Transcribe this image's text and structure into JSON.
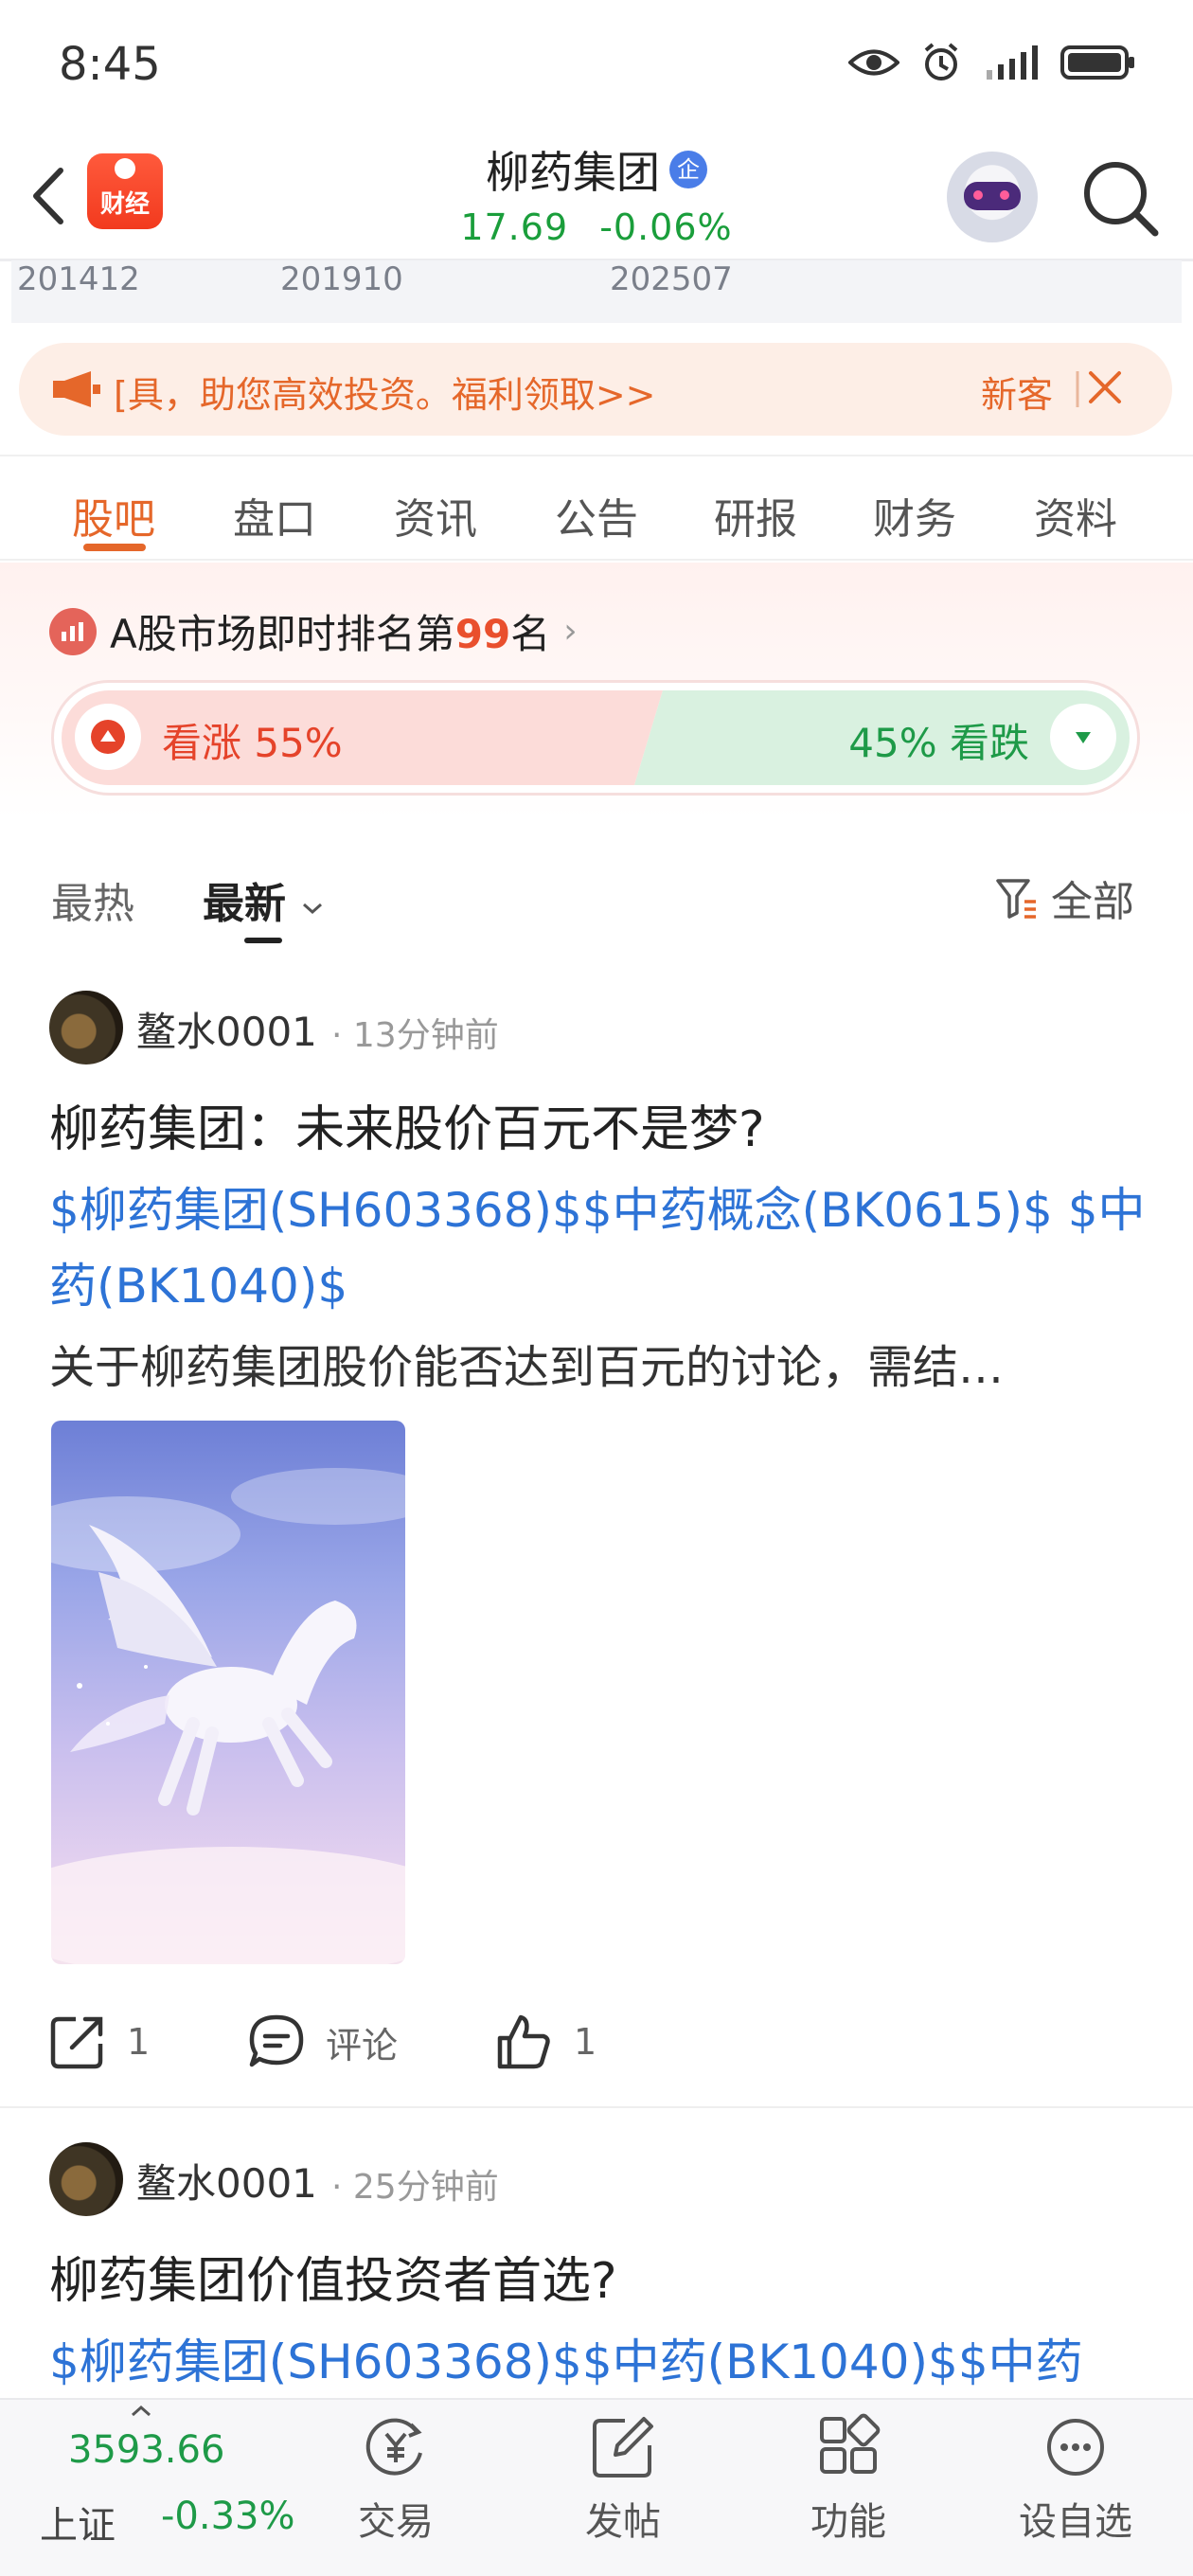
{
  "status": {
    "time": "8:45"
  },
  "header": {
    "logo_label": "财经",
    "stock_name": "柳药集团",
    "badge": "企",
    "price": "17.69",
    "change_pct": "-0.06%"
  },
  "chart_strip": {
    "ticks": [
      "201412",
      "201910",
      "202507"
    ]
  },
  "notice": {
    "text": "[具，助您高效投资。福利领取>>",
    "right_text": "新客"
  },
  "tabs": [
    "股吧",
    "盘口",
    "资讯",
    "公告",
    "研报",
    "财务",
    "资料"
  ],
  "sentiment": {
    "rank_prefix": "A股市场即时排名第",
    "rank_num": "99",
    "rank_suffix": "名",
    "up_label": "看涨 55%",
    "down_label": "45% 看跌",
    "up_fraction": 0.55
  },
  "sort": {
    "hot": "最热",
    "latest": "最新",
    "filter": "全部"
  },
  "posts": [
    {
      "user": "鳌水0001",
      "time": "· 13分钟前",
      "title": "柳药集团：未来股价百元不是梦?",
      "tags": "$柳药集团(SH603368)$$中药概念(BK0615)$ $中药(BK1040)$",
      "body": "关于柳药集团股价能否达到百元的讨论，需结…",
      "share_count": "1",
      "comment_label": "评论",
      "like_count": "1"
    },
    {
      "user": "鳌水0001",
      "time": "· 25分钟前",
      "title": "柳药集团价值投资者首选?",
      "tags": "$柳药集团(SH603368)$$中药(BK1040)$$中药"
    }
  ],
  "bottom": {
    "index_value": "3593.66",
    "index_name": "上证",
    "index_change": "-0.33%",
    "nav": [
      "交易",
      "发帖",
      "功能",
      "设自选"
    ]
  },
  "colors": {
    "accent": "#e5672a",
    "up": "#e5432a",
    "down": "#1e9a48",
    "link": "#2d73d6"
  }
}
